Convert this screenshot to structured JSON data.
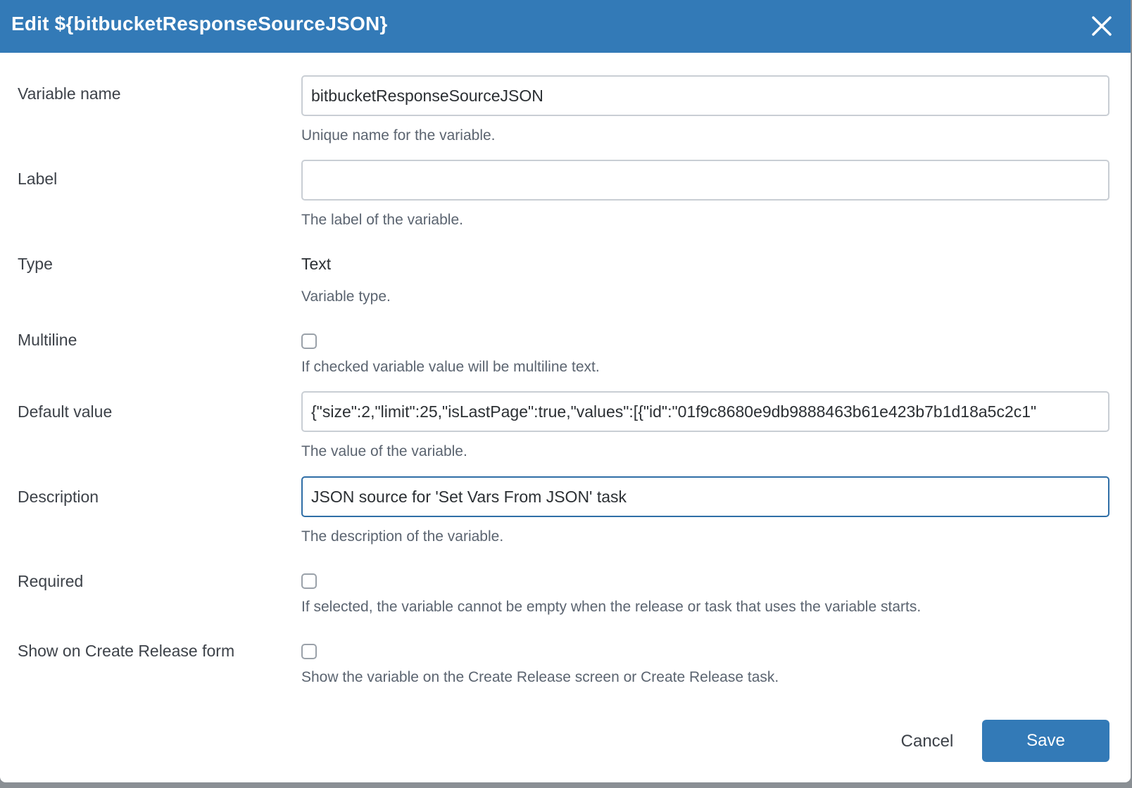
{
  "dialog": {
    "title": "Edit ${bitbucketResponseSourceJSON}",
    "close_icon": "close-icon"
  },
  "fields": {
    "variable_name": {
      "label": "Variable name",
      "value": "bitbucketResponseSourceJSON",
      "help": "Unique name for the variable."
    },
    "label": {
      "label": "Label",
      "value": "",
      "help": "The label of the variable."
    },
    "type": {
      "label": "Type",
      "value": "Text",
      "help": "Variable type."
    },
    "multiline": {
      "label": "Multiline",
      "checked": false,
      "help": "If checked variable value will be multiline text."
    },
    "default_value": {
      "label": "Default value",
      "value": "{\"size\":2,\"limit\":25,\"isLastPage\":true,\"values\":[{\"id\":\"01f9c8680e9db9888463b61e423b7b1d18a5c2c1\"",
      "help": "The value of the variable."
    },
    "description": {
      "label": "Description",
      "value": "JSON source for 'Set Vars From JSON' task",
      "help": "The description of the variable."
    },
    "required": {
      "label": "Required",
      "checked": false,
      "help": "If selected, the variable cannot be empty when the release or task that uses the variable starts."
    },
    "show_on_create": {
      "label": "Show on Create Release form",
      "checked": false,
      "help": "Show the variable on the Create Release screen or Create Release task."
    }
  },
  "footer": {
    "cancel_label": "Cancel",
    "save_label": "Save"
  },
  "colors": {
    "header": "#337ab7",
    "primary_button": "#337ab7",
    "focused_border": "#2f6ea6"
  }
}
